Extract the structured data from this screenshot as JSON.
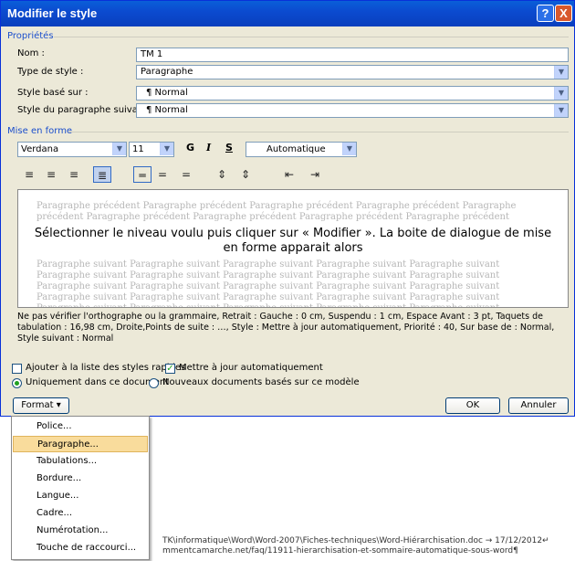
{
  "title_bar": {
    "title": "Modifier le style",
    "help": "?",
    "close": "X"
  },
  "proprietes": {
    "section": "Propriétés",
    "nom_label": "Nom :",
    "nom_value": "TM 1",
    "type_label": "Type de style :",
    "type_value": "Paragraphe",
    "base_label": "Style basé sur :",
    "base_value": "¶ Normal",
    "suivant_label": "Style du paragraphe suivant :",
    "suivant_value": "¶ Normal"
  },
  "mise_en_forme": {
    "section": "Mise en forme",
    "font": "Verdana",
    "size": "11",
    "bold": "G",
    "italic": "I",
    "underline": "S",
    "color": "Automatique"
  },
  "preview": {
    "before": "Paragraphe précédent Paragraphe précédent Paragraphe précédent Paragraphe précédent Paragraphe précédent Paragraphe précédent Paragraphe précédent Paragraphe précédent Paragraphe précédent",
    "main": "Sélectionner le niveau voulu puis cliquer sur « Modifier ». La boite de dialogue de mise en forme apparait alors",
    "after": "Paragraphe suivant Paragraphe suivant Paragraphe suivant Paragraphe suivant Paragraphe suivant Paragraphe suivant Paragraphe suivant Paragraphe suivant Paragraphe suivant Paragraphe suivant Paragraphe suivant Paragraphe suivant Paragraphe suivant Paragraphe suivant Paragraphe suivant Paragraphe suivant Paragraphe suivant Paragraphe suivant Paragraphe suivant Paragraphe suivant Paragraphe suivant Paragraphe suivant Paragraphe suivant Paragraphe suivant Paragraphe suivant Paragraphe suivant Paragraphe suivant Paragraphe suivant Paragraphe suivant"
  },
  "description": "Ne pas vérifier l'orthographe ou la grammaire, Retrait : Gauche : 0 cm, Suspendu : 1 cm, Espace Avant : 3 pt, Taquets de tabulation : 16,98 cm, Droite,Points de suite : …, Style : Mettre à jour automatiquement, Priorité : 40, Sur base de : Normal, Style suivant : Normal",
  "options": {
    "ajouter": "Ajouter à la liste des styles rapides",
    "maj": "Mettre à jour automatiquement",
    "uniquement": "Uniquement dans ce document",
    "nouveaux": "Nouveaux documents basés sur ce modèle"
  },
  "buttons": {
    "format": "Format ▾",
    "ok": "OK",
    "annuler": "Annuler"
  },
  "format_menu": [
    "Police...",
    "Paragraphe...",
    "Tabulations...",
    "Bordure...",
    "Langue...",
    "Cadre...",
    "Numérotation...",
    "Touche de raccourci..."
  ],
  "background_doc": {
    "line1": "TK\\informatique\\Word\\Word-2007\\Fiches-techniques\\Word-Hiérarchisation.doc → 17/12/2012↵",
    "line2": "mmentcamarche.net/faq/11911-hierarchisation-et-sommaire-automatique-sous-word¶"
  },
  "colors": {
    "title_bar": "#0a5fd8",
    "dialog_bg": "#ece9d8",
    "menu_highlight": "#f9dc9c",
    "section_text": "#1c4fcc"
  }
}
